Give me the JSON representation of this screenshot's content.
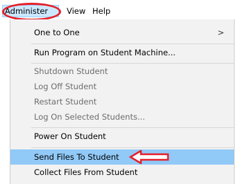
{
  "menubar": {
    "items": [
      {
        "label": "Administer"
      },
      {
        "label": "View"
      },
      {
        "label": "Help"
      }
    ]
  },
  "dropdown": {
    "items": [
      {
        "label": "One to One",
        "submenu_indicator": ">"
      },
      {
        "label": "Run Program on Student Machine..."
      },
      {
        "label": "Shutdown Student"
      },
      {
        "label": "Log Off Student"
      },
      {
        "label": "Restart Student"
      },
      {
        "label": "Log On Selected Students..."
      },
      {
        "label": "Power On Student"
      },
      {
        "label": "Send Files To Student"
      },
      {
        "label": "Collect Files From Student"
      }
    ]
  },
  "colors": {
    "annotation_red": "#e51f2a",
    "highlight": "#91c9f7",
    "menu_background": "#f2f2f2",
    "disabled_text": "#6d6d6d"
  },
  "icons": {
    "submenu": "chevron-right-icon",
    "annotation_arrow": "left-arrow-icon"
  }
}
